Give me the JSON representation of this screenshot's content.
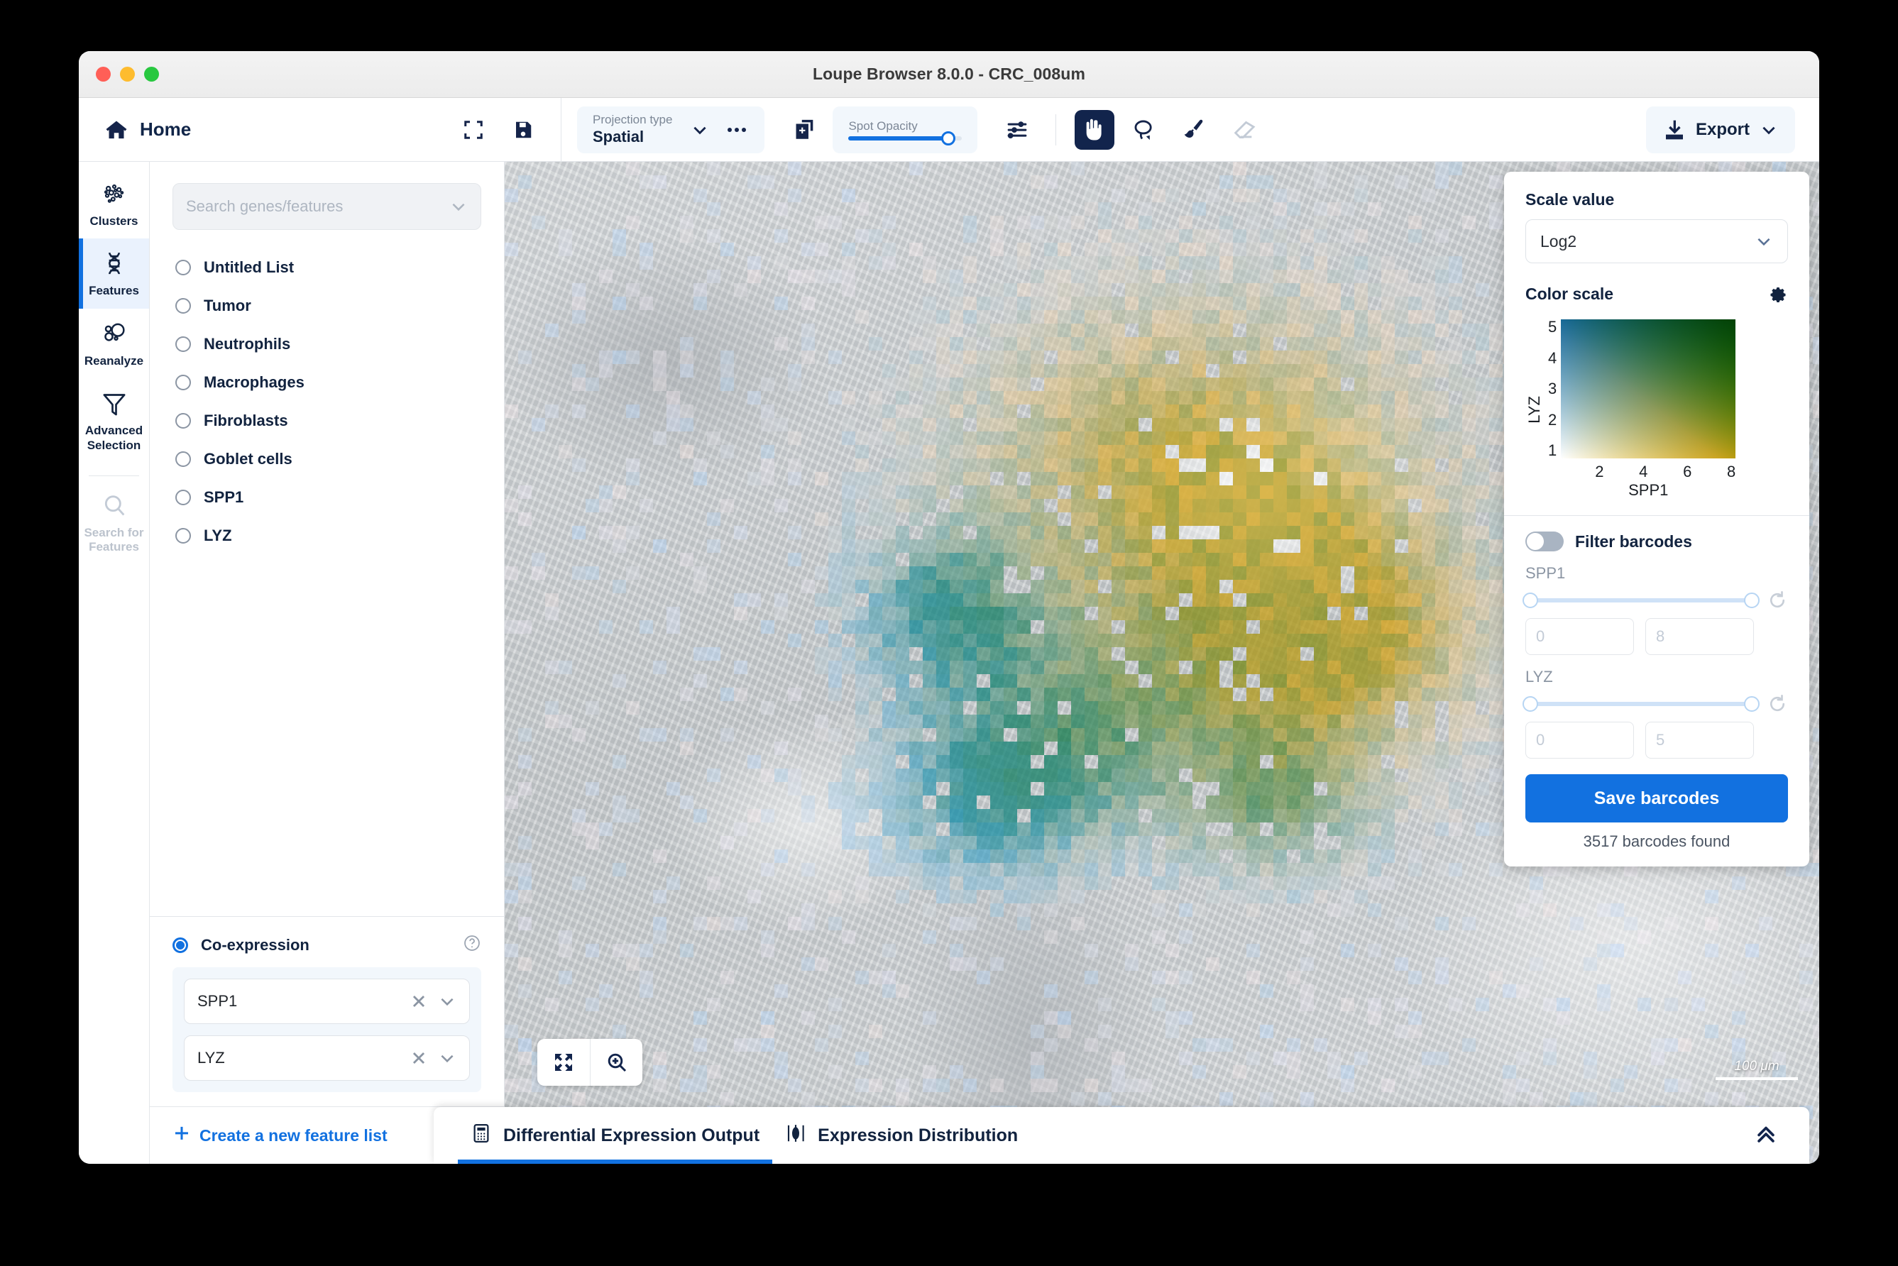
{
  "window": {
    "title": "Loupe Browser 8.0.0 - CRC_008um",
    "traffic_lights": [
      "close",
      "minimize",
      "maximize"
    ]
  },
  "toolbar": {
    "home_label": "Home",
    "fullscreen_icon": "fullscreen-icon",
    "save_icon": "save-icon",
    "projection": {
      "label": "Projection type",
      "value": "Spatial",
      "chevron_icon": "chevron-down-icon",
      "more_icon": "ellipsis-icon"
    },
    "layers_icon": "add-layer-icon",
    "spot_opacity": {
      "label": "Spot Opacity",
      "value": 88
    },
    "settings_icon": "sliders-icon",
    "tools": [
      {
        "name": "pan-tool",
        "icon": "hand-icon",
        "active": true,
        "disabled": false
      },
      {
        "name": "lasso-tool",
        "icon": "lasso-icon",
        "active": false,
        "disabled": false
      },
      {
        "name": "brush-tool",
        "icon": "brush-icon",
        "active": false,
        "disabled": false
      },
      {
        "name": "eraser-tool",
        "icon": "eraser-icon",
        "active": false,
        "disabled": true
      }
    ],
    "export": {
      "label": "Export",
      "icon": "download-icon",
      "chevron_icon": "chevron-down-icon"
    }
  },
  "sidebar": {
    "items": [
      {
        "label": "Clusters",
        "icon": "clusters-icon",
        "active": false,
        "disabled": false
      },
      {
        "label": "Features",
        "icon": "dna-icon",
        "active": true,
        "disabled": false
      },
      {
        "label": "Reanalyze",
        "icon": "reanalyze-icon",
        "active": false,
        "disabled": false
      },
      {
        "label": "Advanced Selection",
        "icon": "filter-icon",
        "active": false,
        "disabled": false
      },
      {
        "label": "Search for Features",
        "icon": "search-icon",
        "active": false,
        "disabled": true
      }
    ]
  },
  "features_panel": {
    "search": {
      "placeholder": "Search genes/features",
      "value": "",
      "chevron_icon": "chevron-down-icon"
    },
    "lists": [
      {
        "label": "Untitled List",
        "selected": false
      },
      {
        "label": "Tumor",
        "selected": false
      },
      {
        "label": "Neutrophils",
        "selected": false
      },
      {
        "label": "Macrophages",
        "selected": false
      },
      {
        "label": "Fibroblasts",
        "selected": false
      },
      {
        "label": "Goblet cells",
        "selected": false
      },
      {
        "label": "SPP1",
        "selected": false
      },
      {
        "label": "LYZ",
        "selected": false
      }
    ],
    "coexpression": {
      "label": "Co-expression",
      "selected": true,
      "help_icon": "question-circle-icon",
      "genes": [
        {
          "name": "SPP1",
          "clear_icon": "close-icon",
          "chevron_icon": "chevron-down-icon"
        },
        {
          "name": "LYZ",
          "clear_icon": "close-icon",
          "chevron_icon": "chevron-down-icon"
        }
      ]
    },
    "footer": {
      "create_label": "Create a new feature list",
      "plus_icon": "plus-icon",
      "upload_icon": "upload-icon"
    }
  },
  "map": {
    "fit_icon": "fit-to-screen-icon",
    "zoom_icon": "zoom-in-icon",
    "scalebar_label": "100 μm"
  },
  "right_panel": {
    "scale_value_label": "Scale value",
    "scale_value": "Log2",
    "scale_chevron_icon": "chevron-down-icon",
    "color_scale_label": "Color scale",
    "gear_icon": "gear-icon",
    "filter": {
      "toggle_label": "Filter barcodes",
      "enabled": false,
      "ranges": [
        {
          "name": "SPP1",
          "min": "0",
          "max": "8",
          "reset_icon": "reset-icon"
        },
        {
          "name": "LYZ",
          "min": "0",
          "max": "5",
          "reset_icon": "reset-icon"
        }
      ]
    },
    "save_label": "Save barcodes",
    "found_label": "3517 barcodes found"
  },
  "chart_data": {
    "type": "heatmap",
    "title": "Color scale",
    "xlabel": "SPP1",
    "ylabel": "LYZ",
    "xticks": [
      "2",
      "4",
      "6",
      "8"
    ],
    "yticks": [
      "5",
      "4",
      "3",
      "2",
      "1"
    ],
    "xlim": [
      0,
      8
    ],
    "ylim": [
      0,
      5
    ],
    "grid": false,
    "legend_position": "none",
    "corner_colors": {
      "bottom_left": "#ffffff",
      "top_left": "#1a7fe0",
      "bottom_right": "#fbb010",
      "top_right": "#16d24a"
    },
    "description": "Bivariate co-expression color key: SPP1 on x-axis (log2 0-8), LYZ on y-axis (log2 0-5)"
  }
}
